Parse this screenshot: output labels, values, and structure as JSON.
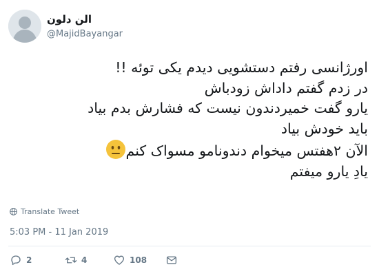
{
  "author": {
    "display_name": "الن دلون",
    "handle": "@MajidBayangar"
  },
  "tweet": {
    "lines": [
      "اورژانسی رفتم دستشویی دیدم یکی توئه !!",
      "در زدم گفتم داداش زودباش",
      "یارو گفت خمیردندون نیست که فشارش بدم بیاد",
      "باید خودش بیاد",
      "الآن ۲هفتس میخوام دندونامو مسواک کنم",
      "یادِ یارو میفتم"
    ],
    "emoji": "neutral-face"
  },
  "translate_label": "Translate Tweet",
  "timestamp": "5:03 PM - 11 Jan 2019",
  "actions": {
    "reply_count": "2",
    "retweet_count": "4",
    "like_count": "108"
  },
  "colors": {
    "text": "#14171a",
    "muted": "#657786",
    "divider": "#e6ecf0",
    "avatar_bg": "#dfe5ea",
    "emoji_face": "#f5c33b"
  }
}
